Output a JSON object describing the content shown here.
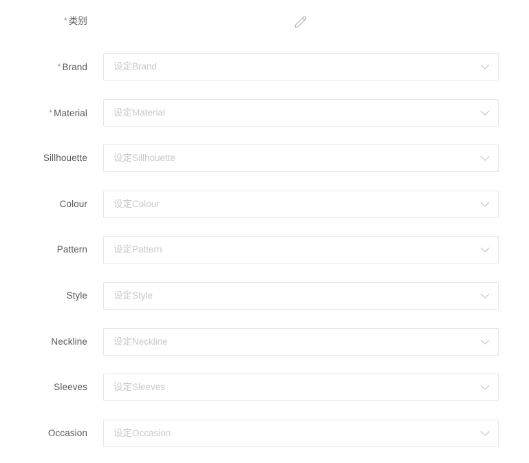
{
  "form": {
    "category_row": {
      "label": "类别",
      "required": true,
      "required_marker": "*",
      "edit_icon": "pencil-icon"
    },
    "placeholder_prefix": "设定",
    "dropdown_icon": "chevron-down-icon",
    "colors": {
      "background": "#ffffff",
      "label_text": "#595959",
      "placeholder_text": "#c9c9c9",
      "field_border": "#e6e6e6",
      "icon": "#bfbfbf"
    },
    "fields": [
      {
        "label": "Brand",
        "required": true,
        "required_marker": "*",
        "placeholder": "设定Brand",
        "value": ""
      },
      {
        "label": "Material",
        "required": true,
        "required_marker": "*",
        "placeholder": "设定Material",
        "value": ""
      },
      {
        "label": "Sillhouette",
        "required": false,
        "required_marker": "",
        "placeholder": "设定Sillhouette",
        "value": ""
      },
      {
        "label": "Colour",
        "required": false,
        "required_marker": "",
        "placeholder": "设定Colour",
        "value": ""
      },
      {
        "label": "Pattern",
        "required": false,
        "required_marker": "",
        "placeholder": "设定Pattern",
        "value": ""
      },
      {
        "label": "Style",
        "required": false,
        "required_marker": "",
        "placeholder": "设定Style",
        "value": ""
      },
      {
        "label": "Neckline",
        "required": false,
        "required_marker": "",
        "placeholder": "设定Neckline",
        "value": ""
      },
      {
        "label": "Sleeves",
        "required": false,
        "required_marker": "",
        "placeholder": "设定Sleeves",
        "value": ""
      },
      {
        "label": "Occasion",
        "required": false,
        "required_marker": "",
        "placeholder": "设定Occasion",
        "value": ""
      }
    ]
  }
}
